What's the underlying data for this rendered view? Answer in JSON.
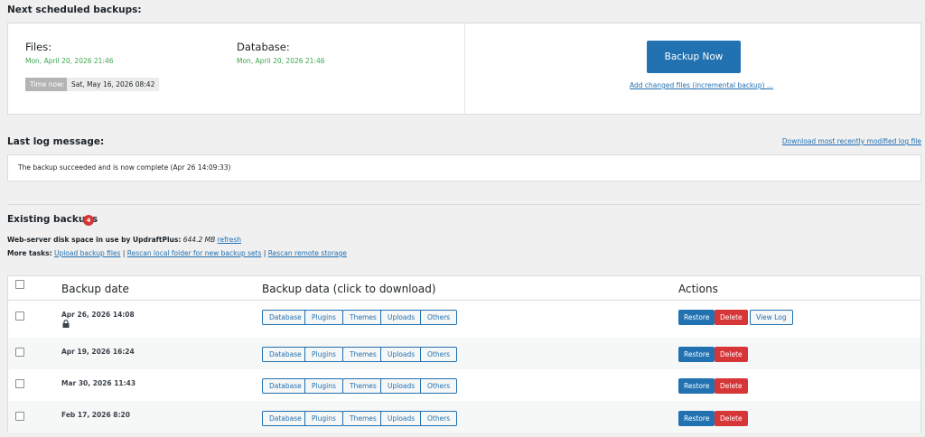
{
  "schedule": {
    "heading": "Next scheduled backups:",
    "files_label": "Files:",
    "files_date": "Mon, April 20, 2026 21:46",
    "database_label": "Database:",
    "database_date": "Mon, April 20, 2026 21:46",
    "time_now_label": "Time now:",
    "time_now_value": "Sat, May 16, 2026 08:42",
    "backup_now_label": "Backup Now",
    "incremental_link": "Add changed files (incremental backup) ..."
  },
  "log": {
    "heading": "Last log message:",
    "download_link": "Download most recently modified log file",
    "message": "The backup succeeded and is now complete (Apr 26 14:09:33)"
  },
  "existing": {
    "heading": "Existing backups",
    "count": "4",
    "disk_label": "Web-server disk space in use by UpdraftPlus:",
    "disk_value": "644.2 MB",
    "refresh_link": "refresh",
    "more_tasks_label": "More tasks:",
    "task_upload": "Upload backup files",
    "task_rescan_local": "Rescan local folder for new backup sets",
    "task_rescan_remote": "Rescan remote storage",
    "separator": "|"
  },
  "table": {
    "col_date": "Backup date",
    "col_data": "Backup data (click to download)",
    "col_actions": "Actions",
    "data_buttons": [
      "Database",
      "Plugins",
      "Themes",
      "Uploads",
      "Others"
    ],
    "restore_label": "Restore",
    "delete_label": "Delete",
    "view_log_label": "View Log",
    "rows": [
      {
        "date": "Apr 26, 2026 14:08"
      },
      {
        "date": "Apr 19, 2026 16:24"
      },
      {
        "date": "Mar 30, 2026 11:43"
      },
      {
        "date": "Feb 17, 2026 8:20"
      }
    ]
  },
  "colors": {
    "primary": "#2271b1",
    "danger": "#d63638",
    "success": "#3aa64a"
  }
}
